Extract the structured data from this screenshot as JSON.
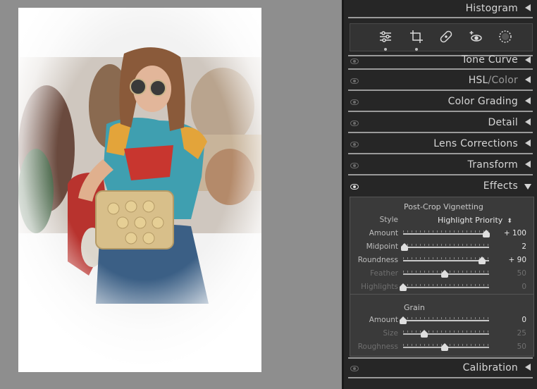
{
  "panels": {
    "histogram": "Histogram",
    "tone_curve": "Tone Curve",
    "hsl": "HSL",
    "hsl_sep": "/",
    "hsl_color": "Color",
    "color_grading": "Color Grading",
    "detail": "Detail",
    "lens_corrections": "Lens Corrections",
    "transform": "Transform",
    "effects": "Effects",
    "calibration": "Calibration"
  },
  "tools": [
    {
      "name": "edit-sliders",
      "icon": "sliders-icon"
    },
    {
      "name": "crop",
      "icon": "crop-icon"
    },
    {
      "name": "healing",
      "icon": "bandage-icon"
    },
    {
      "name": "red-eye",
      "icon": "red-eye-icon"
    },
    {
      "name": "masking",
      "icon": "masking-icon"
    }
  ],
  "effects": {
    "vignette_title": "Post-Crop Vignetting",
    "style_label": "Style",
    "style_value": "Highlight Priority",
    "sliders": [
      {
        "label": "Amount",
        "value": "+ 100",
        "position": 1.0,
        "enabled": true
      },
      {
        "label": "Midpoint",
        "value": "2",
        "position": 0.02,
        "enabled": true
      },
      {
        "label": "Roundness",
        "value": "+ 90",
        "position": 0.95,
        "enabled": true
      },
      {
        "label": "Feather",
        "value": "50",
        "position": 0.5,
        "enabled": false
      },
      {
        "label": "Highlights",
        "value": "0",
        "position": 0.0,
        "enabled": false
      }
    ],
    "grain_title": "Grain",
    "grain_sliders": [
      {
        "label": "Amount",
        "value": "0",
        "position": 0.0,
        "enabled": true
      },
      {
        "label": "Size",
        "value": "25",
        "position": 0.25,
        "enabled": false
      },
      {
        "label": "Roughness",
        "value": "50",
        "position": 0.5,
        "enabled": false
      }
    ]
  },
  "colors": {
    "panel_bg": "#262626",
    "canvas_bg": "#8e8e8e",
    "effects_bg": "#3a3a3a"
  }
}
